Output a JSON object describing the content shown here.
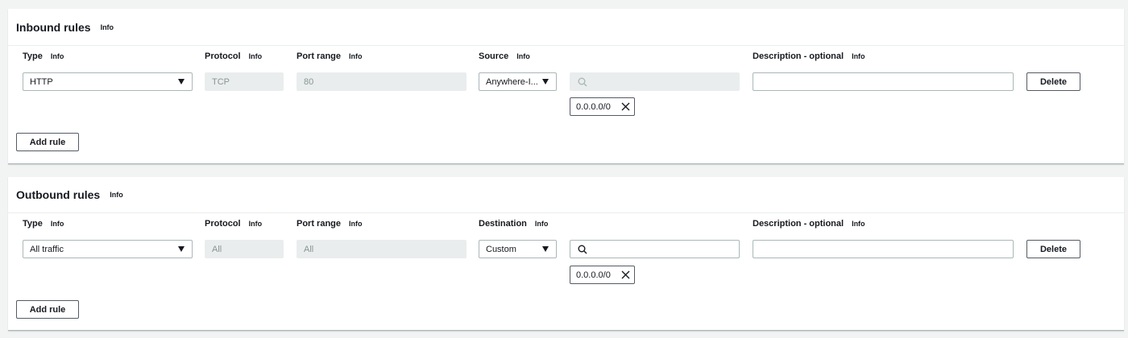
{
  "inbound": {
    "title": "Inbound rules",
    "title_info": "Info",
    "columns": {
      "type": "Type",
      "protocol": "Protocol",
      "port_range": "Port range",
      "source": "Source",
      "description": "Description - optional",
      "info": "Info"
    },
    "row": {
      "type": "HTTP",
      "protocol": "TCP",
      "port_range": "80",
      "source": "Anywhere-I...",
      "search_value": "",
      "description": "",
      "token": "0.0.0.0/0",
      "delete_label": "Delete"
    },
    "add_rule_label": "Add rule"
  },
  "outbound": {
    "title": "Outbound rules",
    "title_info": "Info",
    "columns": {
      "type": "Type",
      "protocol": "Protocol",
      "port_range": "Port range",
      "destination": "Destination",
      "description": "Description - optional",
      "info": "Info"
    },
    "row": {
      "type": "All traffic",
      "protocol": "All",
      "port_range": "All",
      "destination": "Custom",
      "search_value": "",
      "description": "",
      "token": "0.0.0.0/0",
      "delete_label": "Delete"
    },
    "add_rule_label": "Add rule"
  },
  "icons": {
    "caret": "caret-down-icon",
    "search": "search-icon",
    "remove": "close-icon"
  }
}
